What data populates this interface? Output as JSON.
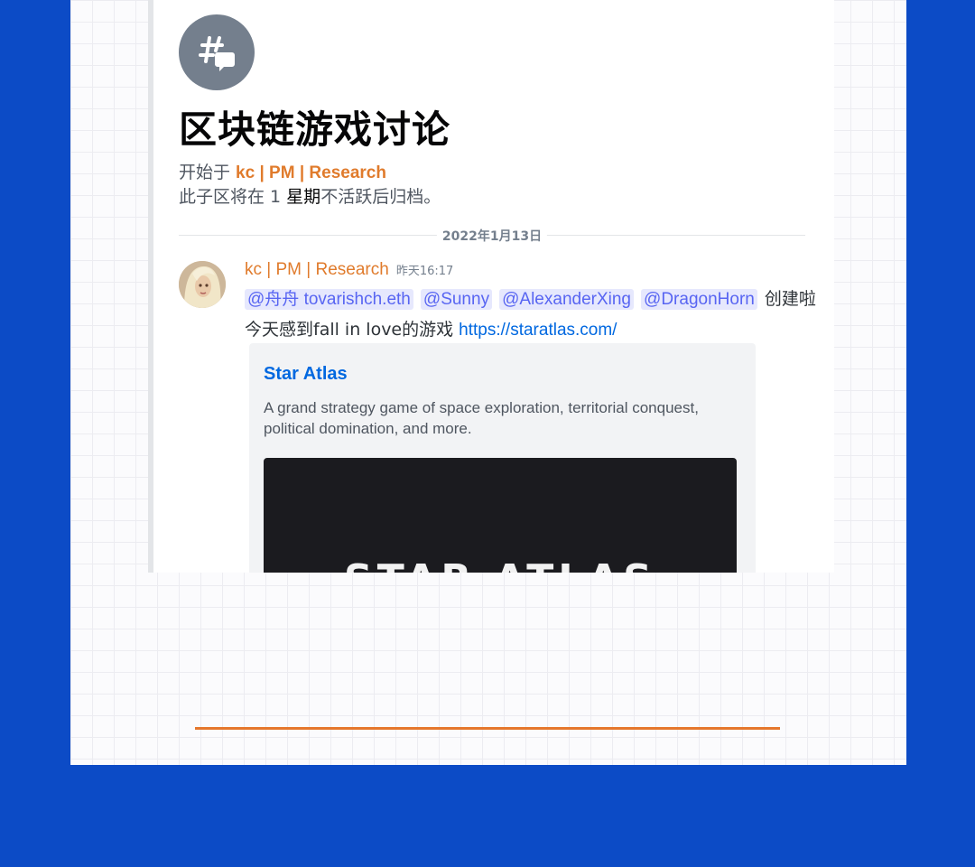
{
  "thread": {
    "icon": "thread-hash-chat-icon",
    "title": "区块链游戏讨论",
    "started_prefix": "开始于 ",
    "started_by": "kc | PM | Research",
    "archive_pre": "此子区将在 1 ",
    "archive_em": "星期",
    "archive_post": "不活跃后归档。"
  },
  "date_divider": "2022年1月13日",
  "message": {
    "avatar": "user-avatar",
    "author": "kc | PM | Research",
    "timestamp": "昨天16:17",
    "mentions": [
      "@舟舟 tovarishch.eth",
      "@Sunny",
      "@AlexanderXing",
      "@DragonHorn"
    ],
    "line1_tail": "创建啦",
    "line2_text": "今天感到fall in love的游戏 ",
    "link": "https://staratlas.com/"
  },
  "embed": {
    "title": "Star Atlas",
    "description": "A grand strategy game of space exploration, territorial conquest, political domination, and more.",
    "image_text": "STAR ATLAS"
  },
  "colors": {
    "background": "#0c4bc6",
    "author": "#e07b2c",
    "link": "#0068e0",
    "mention": "#5865f2",
    "accent_line": "#e5772d"
  }
}
